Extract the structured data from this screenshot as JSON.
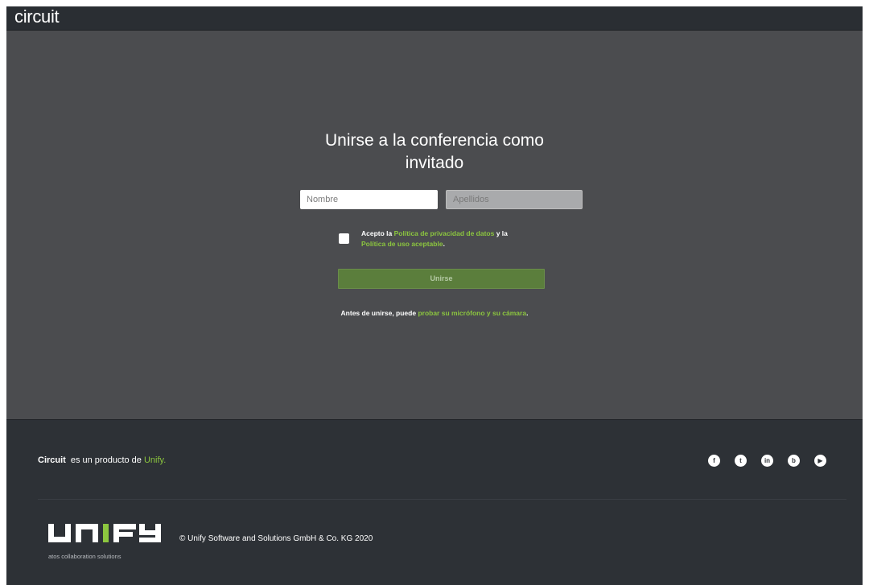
{
  "header": {
    "logo_text": "circuit"
  },
  "form": {
    "title_line1": "Unirse a la conferencia como",
    "title_line2": "invitado",
    "first_name_placeholder": "Nombre",
    "first_name_value": "",
    "last_name_placeholder": "Apellidos",
    "last_name_value": "",
    "consent_checked": false,
    "consent_prefix": "Acepto la ",
    "privacy_link": "Política de privacidad de datos",
    "consent_middle": " y la",
    "usage_link": "Política de uso aceptable",
    "consent_suffix": ".",
    "join_label": "Unirse",
    "pretest_prefix": "Antes de unirse, puede ",
    "pretest_link": "probar su micrófono y su cámara",
    "pretest_suffix": "."
  },
  "footer": {
    "product_name": "Circuit",
    "product_text": "es un producto de",
    "vendor_link": "Unify.",
    "social": [
      {
        "name": "facebook-icon",
        "glyph": "f"
      },
      {
        "name": "twitter-icon",
        "glyph": "t"
      },
      {
        "name": "linkedin-icon",
        "glyph": "in"
      },
      {
        "name": "blog-icon",
        "glyph": "b"
      },
      {
        "name": "youtube-icon",
        "glyph": "▶"
      }
    ],
    "brand_logo_text": "UNIFY",
    "brand_tagline": "atos collaboration solutions",
    "copyright": "© Unify Software and Solutions GmbH & Co. KG 2020"
  },
  "colors": {
    "accent_green": "#8cc63f",
    "button_green": "#5b7e3c",
    "main_bg": "#4b4c4f",
    "footer_bg": "#2d3136"
  }
}
